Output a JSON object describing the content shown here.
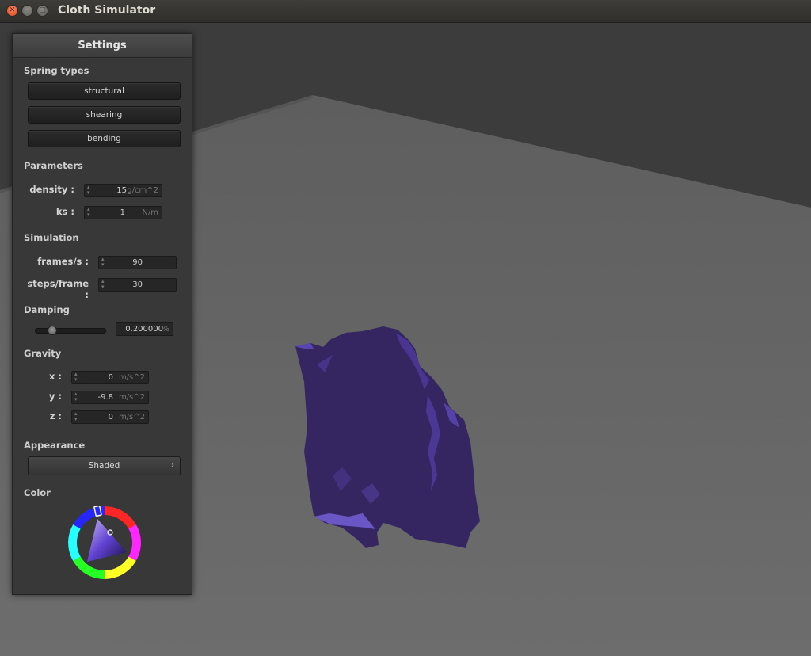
{
  "window": {
    "title": "Cloth Simulator"
  },
  "panel": {
    "title": "Settings",
    "spring_types": {
      "label": "Spring types",
      "buttons": [
        "structural",
        "shearing",
        "bending"
      ]
    },
    "parameters": {
      "label": "Parameters",
      "density": {
        "label": "density :",
        "value": "15",
        "unit": "g/cm^2"
      },
      "ks": {
        "label": "ks :",
        "value": "1",
        "unit": "N/m"
      }
    },
    "simulation": {
      "label": "Simulation",
      "fps": {
        "label": "frames/s :",
        "value": "90"
      },
      "steps": {
        "label": "steps/frame :",
        "value": "30"
      }
    },
    "damping": {
      "label": "Damping",
      "value": "0.200000",
      "unit": "%",
      "slider_fraction": 0.2
    },
    "gravity": {
      "label": "Gravity",
      "x": {
        "label": "x :",
        "value": "0",
        "unit": "m/s^2"
      },
      "y": {
        "label": "y :",
        "value": "-9.8",
        "unit": "m/s^2"
      },
      "z": {
        "label": "z :",
        "value": "0",
        "unit": "m/s^2"
      }
    },
    "appearance": {
      "label": "Appearance",
      "value": "Shaded"
    },
    "color": {
      "label": "Color",
      "current": "#3a2a6a"
    }
  },
  "icons": {
    "close": "close-icon",
    "minimize": "minimize-icon",
    "maximize": "maximize-icon",
    "spin": "spinner-arrows-icon",
    "chevron": "chevron-right-icon"
  }
}
